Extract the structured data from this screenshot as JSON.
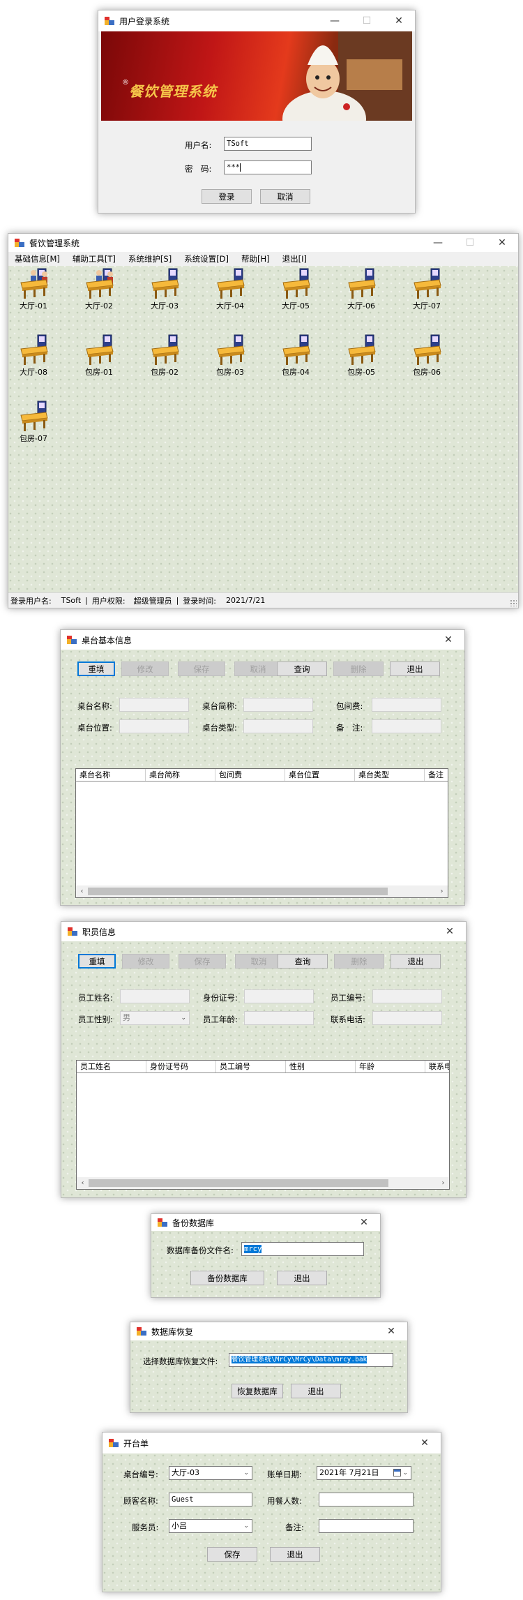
{
  "login": {
    "title": "用户登录系统",
    "banner_text": "餐饮管理系统",
    "banner_mark": "®",
    "username_label": "用户名:",
    "username_value": "TSoft",
    "password_label": "密　码:",
    "password_value": "***",
    "login_button": "登录",
    "cancel_button": "取消"
  },
  "main": {
    "title": "餐饮管理系统",
    "menu": [
      "基础信息[M]",
      "辅助工具[T]",
      "系统维护[S]",
      "系统设置[D]",
      "帮助[H]",
      "退出[I]"
    ],
    "tables": [
      {
        "label": "大厅-01",
        "occupied": true
      },
      {
        "label": "大厅-02",
        "occupied": true
      },
      {
        "label": "大厅-03",
        "occupied": false
      },
      {
        "label": "大厅-04",
        "occupied": false
      },
      {
        "label": "大厅-05",
        "occupied": false
      },
      {
        "label": "大厅-06",
        "occupied": false
      },
      {
        "label": "大厅-07",
        "occupied": false
      },
      {
        "label": "大厅-08",
        "occupied": false
      },
      {
        "label": "包房-01",
        "occupied": false
      },
      {
        "label": "包房-02",
        "occupied": false
      },
      {
        "label": "包房-03",
        "occupied": false
      },
      {
        "label": "包房-04",
        "occupied": false
      },
      {
        "label": "包房-05",
        "occupied": false
      },
      {
        "label": "包房-06",
        "occupied": false
      },
      {
        "label": "包房-07",
        "occupied": false
      }
    ],
    "status": {
      "user_label": "登录用户名:",
      "user_value": "TSoft",
      "role_label": "用户权限:",
      "role_value": "超级管理员",
      "time_label": "登录时间:",
      "time_value": "2021/7/21",
      "separator": "|"
    }
  },
  "table_info": {
    "title": "桌台基本信息",
    "buttons": [
      "重填",
      "修改",
      "保存",
      "取消",
      "查询",
      "删除",
      "退出"
    ],
    "fields": [
      "桌台名称:",
      "桌台简称:",
      "包间费:",
      "桌台位置:",
      "桌台类型:",
      "备　注:"
    ],
    "columns": [
      "桌台名称",
      "桌台简称",
      "包间费",
      "桌台位置",
      "桌台类型",
      "备注"
    ]
  },
  "staff_info": {
    "title": "职员信息",
    "buttons": [
      "重填",
      "修改",
      "保存",
      "取消",
      "查询",
      "删除",
      "退出"
    ],
    "fields": [
      "员工姓名:",
      "身份证号:",
      "员工编号:",
      "员工性别:",
      "员工年龄:",
      "联系电话:"
    ],
    "gender_value": "男",
    "columns": [
      "员工姓名",
      "身份证号码",
      "员工编号",
      "性别",
      "年龄",
      "联系电"
    ]
  },
  "backup": {
    "title": "备份数据库",
    "label": "数据库备份文件名:",
    "value": "mrcy",
    "backup_button": "备份数据库",
    "exit_button": "退出"
  },
  "restore": {
    "title": "数据库恢复",
    "label": "选择数据库恢复文件:",
    "value": "餐饮管理系统\\MrCy\\MrCy\\Data\\mrcy.bak",
    "restore_button": "恢复数据库",
    "exit_button": "退出"
  },
  "open_table": {
    "title": "开台单",
    "table_no_label": "桌台编号:",
    "table_no_value": "大厅-03",
    "date_label": "账单日期:",
    "date_value": "2021年 7月21日",
    "guest_label": "顾客名称:",
    "guest_value": "Guest",
    "diners_label": "用餐人数:",
    "diners_value": "",
    "waiter_label": "服务员:",
    "waiter_value": "小吕",
    "remark_label": "备注:",
    "remark_value": "",
    "save_button": "保存",
    "exit_button": "退出"
  },
  "window_controls": {
    "minimize": "—",
    "maximize": "☐",
    "close": "✕"
  },
  "colors": {
    "accent": "#0078d7",
    "banner_red": "#b01414",
    "banner_text": "#f6c64a"
  }
}
